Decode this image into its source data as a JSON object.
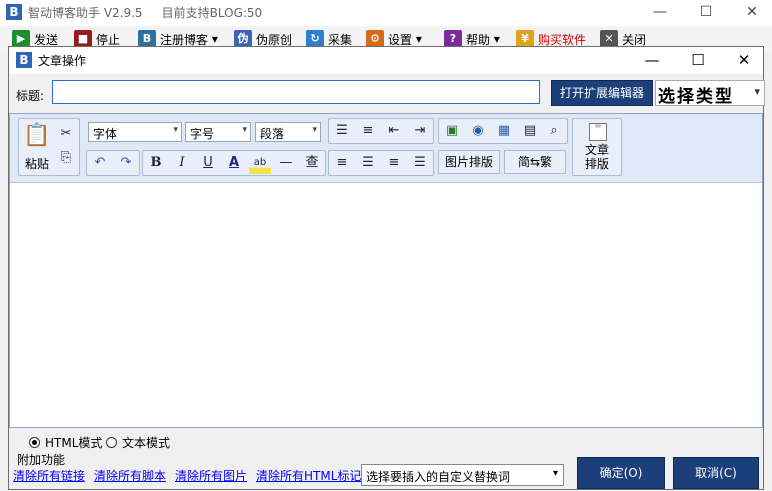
{
  "app": {
    "title": "智动博客助手 V2.9.5",
    "subtitle": "目前支持BLOG:50",
    "toolbar": [
      "发送",
      "停止",
      "注册博客",
      "伪原创",
      "采集",
      "设置",
      "帮助",
      "购买软件",
      "关闭"
    ],
    "window_controls": [
      "—",
      "☐",
      "✕"
    ]
  },
  "dialog": {
    "title": "文章操作",
    "window_controls": [
      "—",
      "☐",
      "✕"
    ],
    "title_label": "标题:",
    "title_value": "",
    "ext_editor_button": "打开扩展编辑器",
    "type_select": "选择类型",
    "editor": {
      "paste_label": "粘贴",
      "font_combo": "字体",
      "size_combo": "字号",
      "para_combo": "段落",
      "img_layout": "图片排版",
      "simp_trad": "简⇆繁",
      "article_layout_1": "文章",
      "article_layout_2": "排版"
    },
    "modes": {
      "html": "HTML模式",
      "text": "文本模式"
    },
    "extra_label": "附加功能",
    "links": [
      "清除所有链接",
      "清除所有脚本",
      "清除所有图片",
      "清除所有HTML标记"
    ],
    "replace_select": "选择要插入的自定义替换词",
    "ok": "确定(O)",
    "cancel": "取消(C)"
  },
  "colors": {
    "accent": "#1c3f7a",
    "logo": "#2f64b4",
    "toolbar_bg": "#dfe8f6"
  }
}
